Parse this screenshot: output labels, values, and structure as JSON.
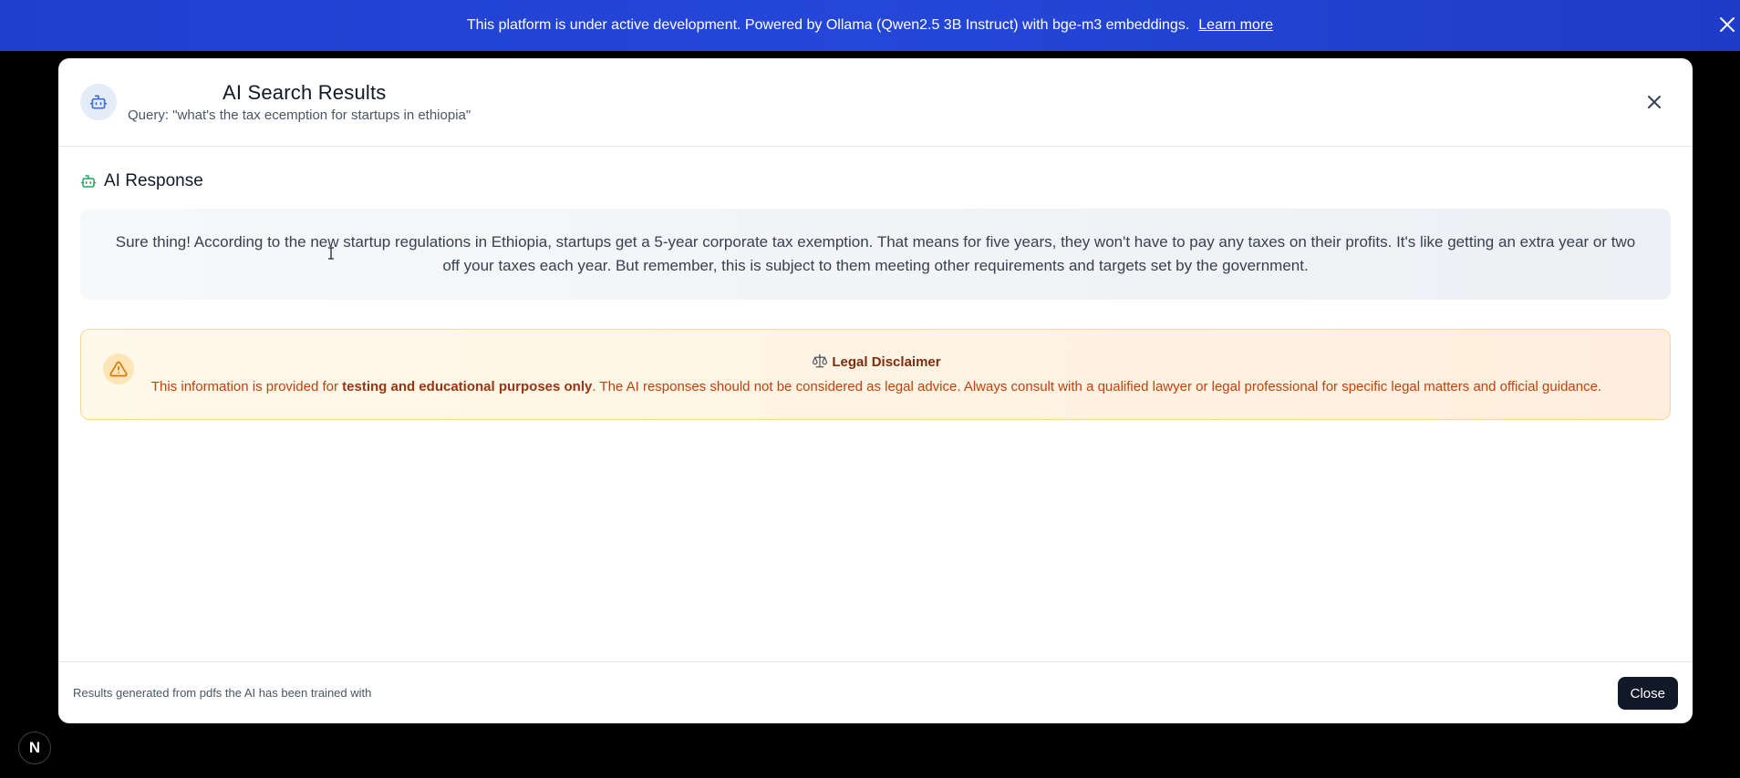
{
  "banner": {
    "message": "This platform is under active development. Powered by Ollama (Qwen2.5 3B Instruct) with bge-m3 embeddings.",
    "link_label": "Learn more",
    "color": "#2547d8"
  },
  "modal": {
    "title": "AI Search Results",
    "query": "Query: \"what's the tax ecemption for startups in ethiopia\"",
    "section_label": "AI Response",
    "response": "Sure thing! According to the new startup regulations in Ethiopia, startups get a 5-year corporate tax exemption. That means for five years, they won't have to pay any taxes on their profits. It's like getting an extra year or two off your taxes each year. But remember, this is subject to them meeting other requirements and targets set by the government.",
    "disclaimer": {
      "title": "Legal Disclaimer",
      "text_before": "This information is provided for ",
      "text_bold": "testing and educational purposes only",
      "text_after": ". The AI responses should not be considered as legal advice. Always consult with a qualified lawyer or legal professional for specific legal matters and official guidance."
    },
    "footer_note": "Results generated from pdfs the AI has been trained with",
    "close_label": "Close"
  },
  "dev_badge": {
    "letter": "N"
  },
  "icons": {
    "banner_close": "close-icon",
    "header_bot": "bot-icon",
    "modal_close": "close-icon",
    "section_bot": "bot-icon",
    "warning": "warning-triangle-icon",
    "scale": "scale-icon"
  },
  "colors": {
    "accent_green": "#22a55a",
    "warning_text": "#c2410c",
    "dark_button": "#111827"
  }
}
